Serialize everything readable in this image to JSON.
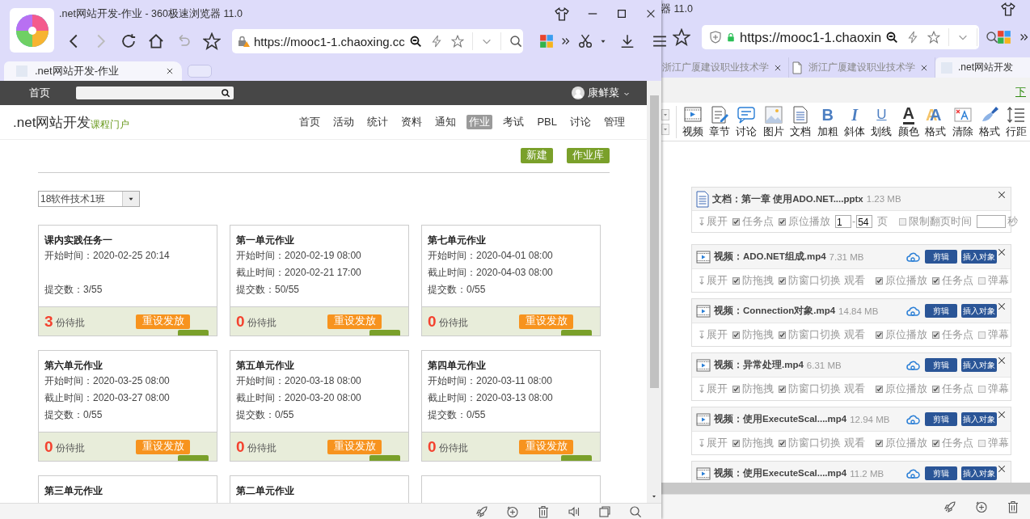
{
  "front_window": {
    "title": ".net网站开发-作业 - 360极速浏览器 11.0",
    "url": "https://mooc1-1.chaoxing.cc",
    "tabs": [
      {
        "label": ".net网站开发-作业",
        "selected": true
      }
    ],
    "site_bar": {
      "home": "首页",
      "user": "康鲜菜"
    },
    "course": {
      "name": ".net网站开发",
      "portal": "课程门户",
      "nav": [
        {
          "label": "首页",
          "selected": false
        },
        {
          "label": "活动",
          "selected": false
        },
        {
          "label": "统计",
          "selected": false
        },
        {
          "label": "资料",
          "selected": false
        },
        {
          "label": "通知",
          "selected": false
        },
        {
          "label": "作业",
          "selected": true
        },
        {
          "label": "考试",
          "selected": false
        },
        {
          "label": "PBL",
          "selected": false
        },
        {
          "label": "讨论",
          "selected": false
        },
        {
          "label": "管理",
          "selected": false
        }
      ]
    },
    "actions": [
      "新建",
      "作业库"
    ],
    "class_select": "18软件技术1班",
    "assignments": [
      {
        "kind": "assignment",
        "title": "课内实践任务一",
        "start": "开始时间：2020-02-25 20:14",
        "submitted": "提交数：3/55",
        "pending": "3",
        "pending_label": "份待批",
        "reset": "重设发放"
      },
      {
        "kind": "assignment",
        "title": "第一单元作业",
        "start": "开始时间：2020-02-19 08:00",
        "end": "截止时间：2020-02-21 17:00",
        "submitted": "提交数：50/55",
        "pending": "0",
        "pending_label": "份待批",
        "reset": "重设发放"
      },
      {
        "kind": "assignment",
        "title": "第七单元作业",
        "start": "开始时间：2020-04-01 08:00",
        "end": "截止时间：2020-04-03 08:00",
        "submitted": "提交数：0/55",
        "pending": "0",
        "pending_label": "份待批",
        "reset": "重设发放"
      },
      {
        "kind": "assignment",
        "title": "第六单元作业",
        "start": "开始时间：2020-03-25 08:00",
        "end": "截止时间：2020-03-27 08:00",
        "submitted": "提交数：0/55",
        "pending": "0",
        "pending_label": "份待批",
        "reset": "重设发放"
      },
      {
        "kind": "assignment",
        "title": "第五单元作业",
        "start": "开始时间：2020-03-18 08:00",
        "end": "截止时间：2020-03-20 08:00",
        "submitted": "提交数：0/55",
        "pending": "0",
        "pending_label": "份待批",
        "reset": "重设发放"
      },
      {
        "kind": "assignment",
        "title": "第四单元作业",
        "start": "开始时间：2020-03-11 08:00",
        "end": "截止时间：2020-03-13 08:00",
        "submitted": "提交数：0/55",
        "pending": "0",
        "pending_label": "份待批",
        "reset": "重设发放"
      },
      {
        "kind": "assignment",
        "title": "第三单元作业"
      },
      {
        "kind": "assignment",
        "title": "第二单元作业"
      },
      {
        "kind": "blank"
      }
    ]
  },
  "back_window": {
    "title": "器 11.0",
    "url": "https://mooc1-1.chaoxin",
    "tabs": [
      {
        "kind": "plain",
        "label": "浙江广厦建设职业技术学",
        "selected": false,
        "closable": true
      },
      {
        "kind": "document",
        "label": "浙江广厦建设职业技术学",
        "selected": false,
        "closable": true
      },
      {
        "kind": "site",
        "label": ".net网站开发",
        "selected": true,
        "closable": false
      }
    ],
    "download_link": "下",
    "toolbar": [
      {
        "kind": "video",
        "label": "视频"
      },
      {
        "kind": "chapter",
        "label": "章节"
      },
      {
        "kind": "discussion",
        "label": "讨论"
      },
      {
        "kind": "image",
        "label": "图片"
      },
      {
        "kind": "document",
        "label": "文档"
      },
      {
        "kind": "bold",
        "glyph": "B",
        "label": "加粗"
      },
      {
        "kind": "italic",
        "glyph": "I",
        "label": "斜体"
      },
      {
        "kind": "underline",
        "glyph": "U",
        "label": "划线"
      },
      {
        "kind": "fontcolor",
        "glyph": "A",
        "label": "颜色"
      },
      {
        "kind": "fontformat",
        "glyph": "A",
        "label": "格式"
      },
      {
        "kind": "clear",
        "label": "清除"
      },
      {
        "kind": "brush",
        "label": "格式"
      },
      {
        "kind": "spacing",
        "label": "行距"
      }
    ],
    "attachments": [
      {
        "kind": "document",
        "title": "文档：第一章 使用ADO.NET....pptx",
        "size": "1.23 MB",
        "expand": "展开",
        "checks": [
          {
            "label": "任务点",
            "checked": true
          },
          {
            "label": "原位播放",
            "checked": true
          }
        ],
        "page_from": "1",
        "page_sep": "-",
        "page_to": "54",
        "page_unit": "页",
        "limit": {
          "label": "限制翻页时间",
          "checked": false
        },
        "limit_unit": "秒"
      },
      {
        "kind": "video",
        "title": "视频：ADO.NET组成.mp4",
        "size": "7.31 MB",
        "edit": "剪辑",
        "insert": "插入对象",
        "expand": "展开",
        "left_checks": [
          {
            "label": "防拖拽",
            "checked": true
          },
          {
            "label": "防窗口切换",
            "checked": true
          }
        ],
        "note": "观看",
        "right_checks": [
          {
            "label": "原位播放",
            "checked": true
          },
          {
            "label": "任务点",
            "checked": true
          },
          {
            "label": "弹幕",
            "checked": false
          }
        ]
      },
      {
        "kind": "video",
        "title": "视频：Connection对象.mp4",
        "size": "14.84 MB",
        "edit": "剪辑",
        "insert": "插入对象",
        "expand": "展开",
        "left_checks": [
          {
            "label": "防拖拽",
            "checked": true
          },
          {
            "label": "防窗口切换",
            "checked": true
          }
        ],
        "note": "观看",
        "right_checks": [
          {
            "label": "原位播放",
            "checked": true
          },
          {
            "label": "任务点",
            "checked": true
          },
          {
            "label": "弹幕",
            "checked": false
          }
        ]
      },
      {
        "kind": "video",
        "title": "视频：异常处理.mp4",
        "size": "6.31 MB",
        "edit": "剪辑",
        "insert": "插入对象",
        "expand": "展开",
        "left_checks": [
          {
            "label": "防拖拽",
            "checked": true
          },
          {
            "label": "防窗口切换",
            "checked": true
          }
        ],
        "note": "观看",
        "right_checks": [
          {
            "label": "原位播放",
            "checked": true
          },
          {
            "label": "任务点",
            "checked": true
          },
          {
            "label": "弹幕",
            "checked": false
          }
        ]
      },
      {
        "kind": "video",
        "title": "视频：使用ExecuteScal....mp4",
        "size": "12.94 MB",
        "edit": "剪辑",
        "insert": "插入对象",
        "expand": "展开",
        "left_checks": [
          {
            "label": "防拖拽",
            "checked": true
          },
          {
            "label": "防窗口切换",
            "checked": true
          }
        ],
        "note": "观看",
        "right_checks": [
          {
            "label": "原位播放",
            "checked": true
          },
          {
            "label": "任务点",
            "checked": true
          },
          {
            "label": "弹幕",
            "checked": false
          }
        ]
      },
      {
        "kind": "video",
        "title": "视频：使用ExecuteScal....mp4",
        "size": "11.2 MB",
        "edit": "剪辑",
        "insert": "插入对象"
      }
    ]
  }
}
